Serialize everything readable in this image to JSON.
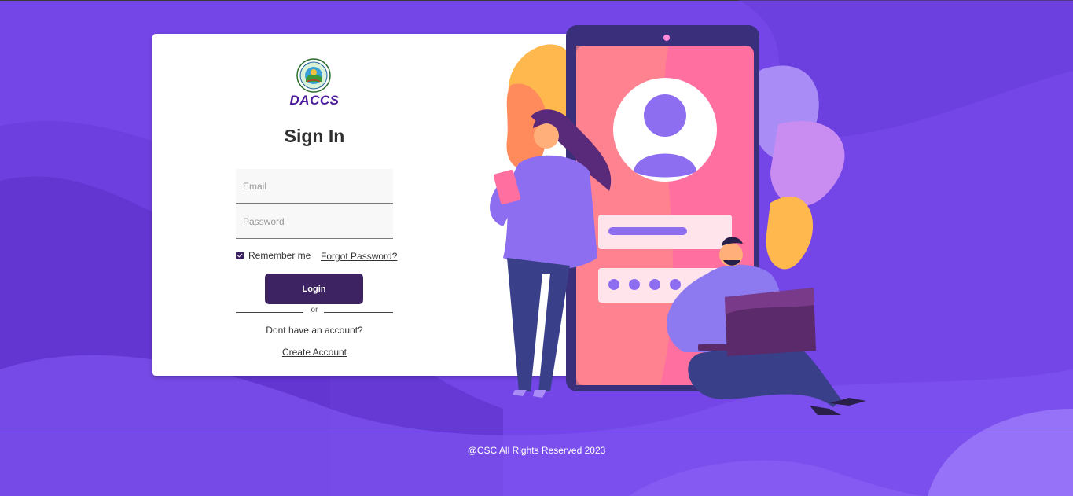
{
  "brand": {
    "name": "DACCS"
  },
  "signin": {
    "title": "Sign In",
    "email_placeholder": "Email",
    "password_placeholder": "Password",
    "remember_label": "Remember me",
    "remember_checked": true,
    "forgot_label": "Forgot Password?",
    "login_label": "Login",
    "or_label": "or",
    "no_account_text": "Dont have an account?",
    "create_label": "Create Account"
  },
  "footer": {
    "text": "@CSC All Rights Reserved 2023"
  },
  "colors": {
    "background": "#7446e8",
    "button": "#3d2361",
    "brand": "#4b1a9b"
  }
}
